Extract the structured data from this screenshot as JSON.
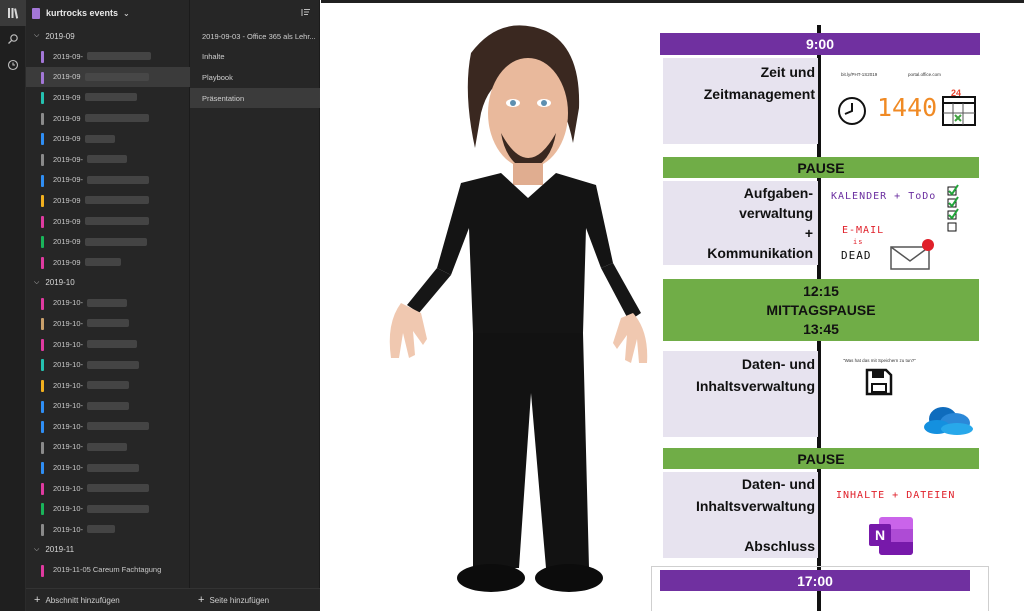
{
  "notebook": {
    "title": "kurtrocks events"
  },
  "sections": {
    "groups": [
      {
        "label": "2019-09",
        "items": [
          {
            "label": "2019-09-",
            "color": "#a377d7"
          },
          {
            "label": "2019-09",
            "color": "#a377d7"
          },
          {
            "label": "2019-09",
            "color": "#25c1b0"
          },
          {
            "label": "2019-09",
            "color": "#8a8a8a"
          },
          {
            "label": "2019-09",
            "color": "#2f8ef4"
          },
          {
            "label": "2019-09-",
            "color": "#8a8a8a"
          },
          {
            "label": "2019-09-",
            "color": "#2f8ef4"
          },
          {
            "label": "2019-09",
            "color": "#f2b01e"
          },
          {
            "label": "2019-09",
            "color": "#e03aa0"
          },
          {
            "label": "2019-09",
            "color": "#19b45a"
          },
          {
            "label": "2019-09",
            "color": "#e03aa0"
          }
        ]
      },
      {
        "label": "2019-10",
        "items": [
          {
            "label": "2019-10-",
            "color": "#e03aa0"
          },
          {
            "label": "2019-10-",
            "color": "#c9a06b"
          },
          {
            "label": "2019-10-",
            "color": "#e03aa0"
          },
          {
            "label": "2019-10-",
            "color": "#25c1b0"
          },
          {
            "label": "2019-10-",
            "color": "#f2b01e"
          },
          {
            "label": "2019-10-",
            "color": "#2f8ef4"
          },
          {
            "label": "2019-10-",
            "color": "#2f8ef4"
          },
          {
            "label": "2019-10-",
            "color": "#8a8a8a"
          },
          {
            "label": "2019-10-",
            "color": "#2f8ef4"
          },
          {
            "label": "2019-10-",
            "color": "#e03aa0"
          },
          {
            "label": "2019-10-",
            "color": "#19b45a"
          },
          {
            "label": "2019-10-",
            "color": "#8a8a8a"
          }
        ]
      },
      {
        "label": "2019-11",
        "items": [
          {
            "label": "2019-11-05 Careum Fachtagung",
            "color": "#e03aa0"
          }
        ]
      }
    ],
    "add_label": "Abschnitt hinzufügen"
  },
  "pages": {
    "items": [
      {
        "label": "2019-09-03 - Office 365 als Lehr..."
      },
      {
        "label": "Inhalte"
      },
      {
        "label": "Playbook"
      },
      {
        "label": "Präsentation"
      }
    ],
    "add_label": "Seite hinzufügen"
  },
  "canvas": {
    "time_start": "9:00",
    "block1_line1": "Zeit und",
    "block1_line2": "Zeitmanagement",
    "block1_link1": "bit.ly/PHT-1S2019",
    "block1_link2": "portal.office.com",
    "block1_number": "1440",
    "calendar_day": "24",
    "pause1": "PAUSE",
    "block2_line1": "Aufgaben-",
    "block2_line2": "verwaltung",
    "block2_line3": "+",
    "block2_line4": "Kommunikation",
    "block2_note1": "KALENDER + ToDo",
    "block2_note2a": "E-MAIL",
    "block2_note2b": "is",
    "block2_note2c": "DEAD",
    "lunch_start": "12:15",
    "lunch_label": "MITTAGSPAUSE",
    "lunch_end": "13:45",
    "block3_line1": "Daten- und",
    "block3_line2": "Inhaltsverwaltung",
    "block3_quote": "\"Was hat das mit Speichern zu tun?\"",
    "pause2": "PAUSE",
    "block4_line1": "Daten- und",
    "block4_line2": "Inhaltsverwaltung",
    "block4_line3": "Abschluss",
    "block4_note": "INHALTE + DATEIEN",
    "onenote_letter": "N",
    "time_end": "17:00"
  },
  "colors": {
    "purple": "#7030a0",
    "green": "#70ad47",
    "accent": "#a377d7"
  },
  "icons": [
    "library-icon",
    "search-icon",
    "recent-icon",
    "sort-icon",
    "clock-icon",
    "calendar-icon",
    "checklist-icon",
    "mail-icon",
    "floppy-disk-icon",
    "onedrive-icon",
    "onenote-icon",
    "avatar-illustration"
  ]
}
